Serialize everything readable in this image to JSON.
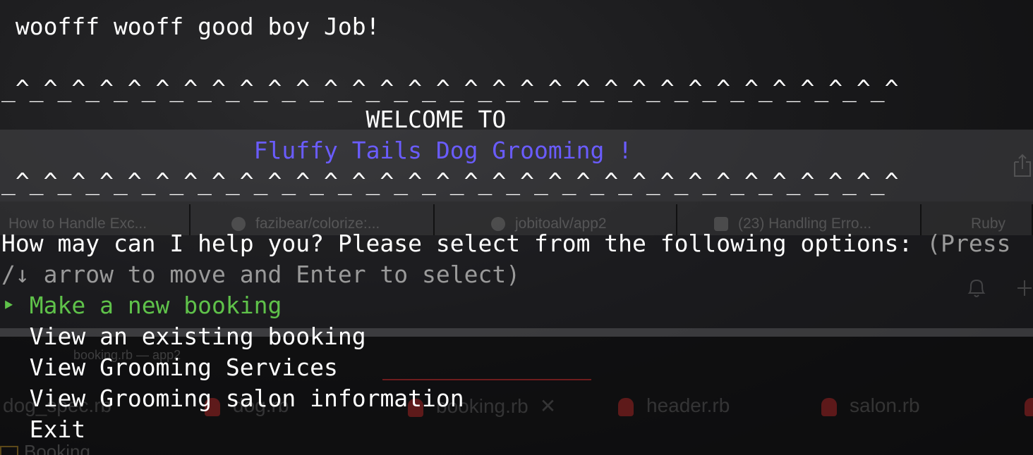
{
  "terminal": {
    "greeting": " woofff wooff good boy Job!",
    "border_top": "_^_^_^_^_^_^_^_^_^_^_^_^_^_^_^_^_^_^_^_^_^_^_^_^_^_^_^_^_^_^_^_^",
    "welcome": "                          WELCOME TO",
    "salon_indent": "                  ",
    "salon_name": "Fluffy Tails Dog Grooming !",
    "border_bottom": "_^_^_^_^_^_^_^_^_^_^_^_^_^_^_^_^_^_^_^_^_^_^_^_^_^_^_^_^_^_^_^_^",
    "prompt_question": "How may can I help you? Please select from the following options: ",
    "prompt_hint_a": "(Press",
    "prompt_hint_b": "/↓ arrow to move and Enter to select)",
    "selected_marker": "‣",
    "menu": [
      "Make a new booking",
      "View an existing booking",
      "View Grooming Services",
      "View Grooming salon information",
      "Exit"
    ]
  },
  "background": {
    "tabs": [
      "How to Handle Exc...",
      "fazibear/colorize:...",
      "jobitoalv/app2",
      "(23) Handling Erro...",
      "Ruby"
    ],
    "panel_label": "booking.rb — app2",
    "files": [
      "dog_spec.rb",
      "dog.rb",
      "booking.rb",
      "header.rb",
      "salon.rb"
    ],
    "folder": "Booking"
  },
  "colors": {
    "salon_name": "#6a5cff",
    "selected_option": "#5fc24a",
    "hint": "#9a9a9a"
  }
}
